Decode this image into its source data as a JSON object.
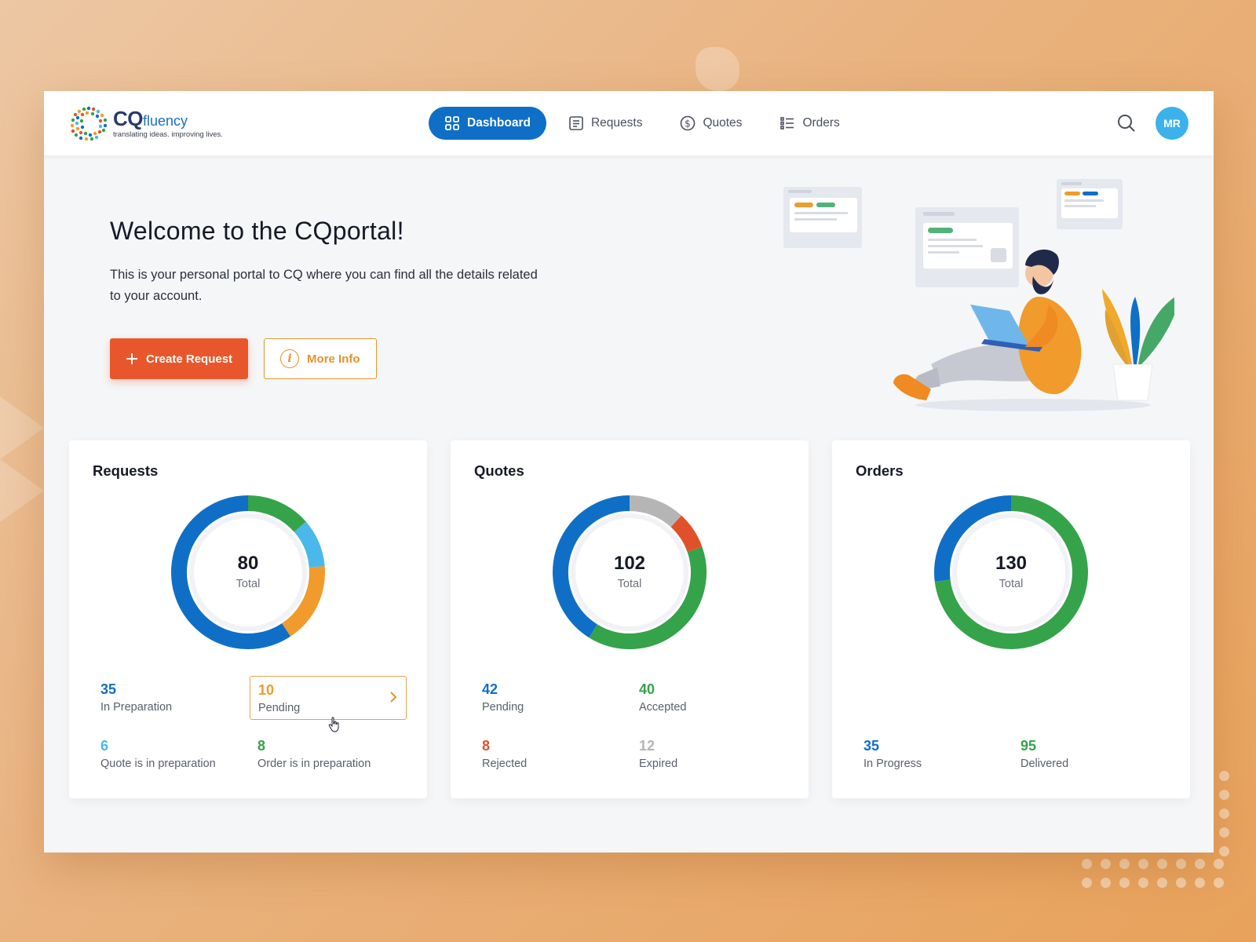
{
  "brand": {
    "name_cq": "CQ",
    "name_fluency": "fluency",
    "tagline": "translating ideas. improving lives."
  },
  "nav": {
    "items": [
      {
        "label": "Dashboard",
        "icon": "grid-icon",
        "active": true
      },
      {
        "label": "Requests",
        "icon": "document-icon",
        "active": false
      },
      {
        "label": "Quotes",
        "icon": "dollar-icon",
        "active": false
      },
      {
        "label": "Orders",
        "icon": "list-icon",
        "active": false
      }
    ],
    "user_initials": "MR"
  },
  "hero": {
    "title": "Welcome to the CQportal!",
    "description": "This is your personal portal to CQ where you can find all the details related to your account.",
    "create_button": "Create Request",
    "more_button": "More Info"
  },
  "colors": {
    "primary_blue": "#0f6fc6",
    "orange": "#e8572c",
    "amber": "#f09b2b",
    "green": "#34a34a",
    "light_blue": "#4ab8ea",
    "red": "#e0512a",
    "gray": "#b5b5b5"
  },
  "cards": [
    {
      "title": "Requests",
      "total": "80",
      "total_label": "Total",
      "segments": [
        {
          "value": 35,
          "color": "#0f6fc6"
        },
        {
          "value": 10,
          "color": "#f09b2b"
        },
        {
          "value": 6,
          "color": "#4ab8ea"
        },
        {
          "value": 8,
          "color": "#34a34a"
        }
      ],
      "stats": [
        {
          "num": "35",
          "label": "In Preparation",
          "color": "#0f6fc6"
        },
        {
          "num": "10",
          "label": "Pending",
          "color": "#f09b2b"
        },
        {
          "num": "6",
          "label": "Quote is in preparation",
          "color": "#4ab8ea"
        },
        {
          "num": "8",
          "label": "Order is in preparation",
          "color": "#34a34a"
        }
      ]
    },
    {
      "title": "Quotes",
      "total": "102",
      "total_label": "Total",
      "segments": [
        {
          "value": 42,
          "color": "#0f6fc6"
        },
        {
          "value": 40,
          "color": "#34a34a"
        },
        {
          "value": 8,
          "color": "#e0512a"
        },
        {
          "value": 12,
          "color": "#b5b5b5"
        }
      ],
      "stats": [
        {
          "num": "42",
          "label": "Pending",
          "color": "#0f6fc6"
        },
        {
          "num": "40",
          "label": "Accepted",
          "color": "#34a34a"
        },
        {
          "num": "8",
          "label": "Rejected",
          "color": "#e0512a"
        },
        {
          "num": "12",
          "label": "Expired",
          "color": "#b5b5b5"
        }
      ]
    },
    {
      "title": "Orders",
      "total": "130",
      "total_label": "Total",
      "segments": [
        {
          "value": 35,
          "color": "#0f6fc6"
        },
        {
          "value": 95,
          "color": "#34a34a"
        }
      ],
      "stats": [
        {
          "num": "35",
          "label": "In Progress",
          "color": "#0f6fc6"
        },
        {
          "num": "95",
          "label": "Delivered",
          "color": "#34a34a"
        }
      ]
    }
  ]
}
